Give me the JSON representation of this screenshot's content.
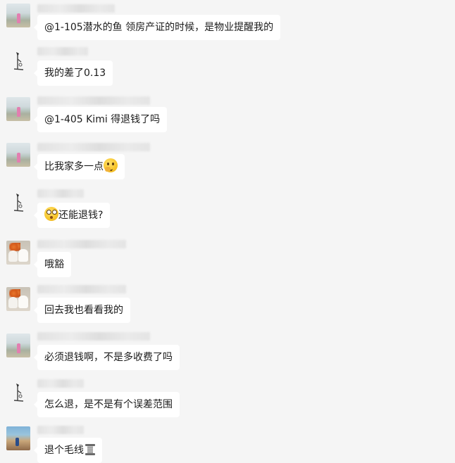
{
  "messages": [
    {
      "avatar": "beach-portrait-avatar",
      "text": "@1-105潜水的鱼 领房产证的时候，是物业提醒我的"
    },
    {
      "avatar": "sketch-figure-avatar",
      "text": "我的差了0.13"
    },
    {
      "avatar": "beach-portrait-avatar",
      "text": "@1-405 Kimi 得退钱了吗"
    },
    {
      "avatar": "beach-portrait-avatar",
      "text": "比我家多一点",
      "emoji_after": "thinking-face-emoji"
    },
    {
      "avatar": "sketch-figure-avatar",
      "text": "还能退钱?",
      "emoji_before": "astonished-face-emoji"
    },
    {
      "avatar": "dogs-flowers-avatar",
      "text": "哦豁"
    },
    {
      "avatar": "dogs-flowers-avatar",
      "text": "回去我也看看我的"
    },
    {
      "avatar": "beach-portrait-avatar",
      "text": "必须退钱啊，不是多收费了吗"
    },
    {
      "avatar": "sketch-figure-avatar",
      "text": "怎么退，是不是有个误差范围"
    },
    {
      "avatar": "coastal-scene-avatar",
      "text": "退个毛线",
      "emoji_after": "thread-spool-emoji"
    }
  ],
  "colors": {
    "background": "#f5f5f5",
    "bubble": "#ffffff",
    "text": "#1a1a1a"
  }
}
